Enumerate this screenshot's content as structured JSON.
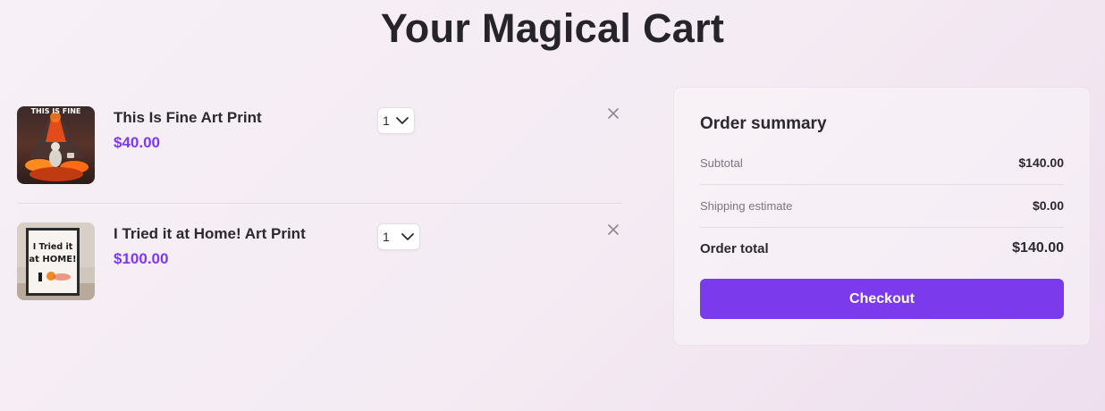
{
  "page": {
    "title": "Your Magical Cart"
  },
  "cart": {
    "items": [
      {
        "name": "This Is Fine Art Print",
        "price": "$40.00",
        "quantity": "1",
        "image_caption": "THIS IS FINE",
        "image_icon": "volcano-skeleton-image"
      },
      {
        "name": "I Tried it at Home! Art Print",
        "price": "$100.00",
        "quantity": "1",
        "image_caption_line1": "I Tried it",
        "image_caption_line2": "at HOME!",
        "image_icon": "framed-poster-image"
      }
    ],
    "remove_icon": "close-icon",
    "select_icon": "chevron-down-icon"
  },
  "summary": {
    "title": "Order summary",
    "subtotal_label": "Subtotal",
    "subtotal_value": "$140.00",
    "shipping_label": "Shipping estimate",
    "shipping_value": "$0.00",
    "total_label": "Order total",
    "total_value": "$140.00",
    "checkout_label": "Checkout"
  },
  "colors": {
    "accent": "#7c3aed",
    "text": "#26232b",
    "muted": "#7a7480"
  }
}
